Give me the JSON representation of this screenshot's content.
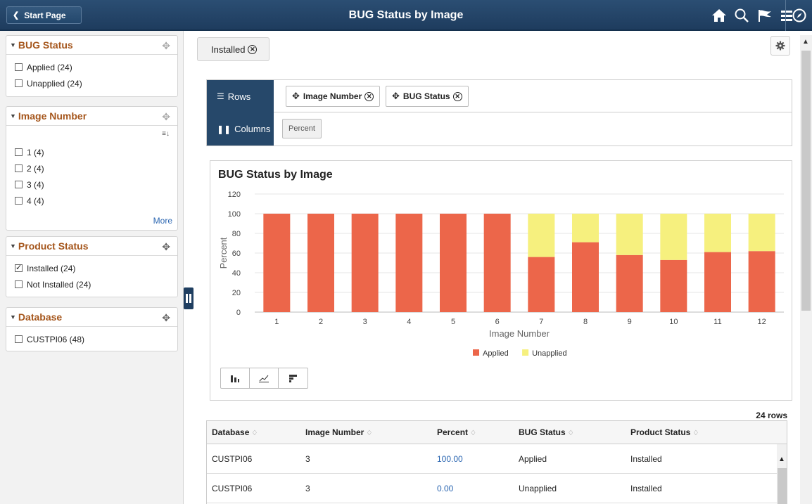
{
  "header": {
    "start_label": "Start Page",
    "title": "BUG Status by Image",
    "icons": [
      "home-icon",
      "search-icon",
      "flag-icon",
      "menu-icon",
      "compass-icon"
    ]
  },
  "facets": [
    {
      "title": "BUG Status",
      "items": [
        {
          "label": "Applied (24)",
          "checked": false
        },
        {
          "label": "Unapplied (24)",
          "checked": false
        }
      ]
    },
    {
      "title": "Image Number",
      "items": [
        {
          "label": "1 (4)",
          "checked": false
        },
        {
          "label": "2 (4)",
          "checked": false
        },
        {
          "label": "3 (4)",
          "checked": false
        },
        {
          "label": "4 (4)",
          "checked": false
        }
      ],
      "more": "More"
    },
    {
      "title": "Product Status",
      "items": [
        {
          "label": "Installed (24)",
          "checked": true
        },
        {
          "label": "Not Installed (24)",
          "checked": false
        }
      ]
    },
    {
      "title": "Database",
      "items": [
        {
          "label": "CUSTPI06 (48)",
          "checked": false
        }
      ]
    }
  ],
  "filter_chip": "Installed",
  "pivot": {
    "rows_label": "Rows",
    "columns_label": "Columns",
    "row_fields": [
      "Image Number",
      "BUG Status"
    ],
    "column_fields": [
      "Percent"
    ]
  },
  "chart_data": {
    "type": "bar",
    "stacked": true,
    "title": "BUG Status by Image",
    "xlabel": "Image Number",
    "ylabel": "Percent",
    "ylim": [
      0,
      120
    ],
    "yticks": [
      0,
      20,
      40,
      60,
      80,
      100,
      120
    ],
    "categories": [
      "1",
      "2",
      "3",
      "4",
      "5",
      "6",
      "7",
      "8",
      "9",
      "10",
      "11",
      "12"
    ],
    "series": [
      {
        "name": "Applied",
        "color": "#ec664a",
        "values": [
          100,
          100,
          100,
          100,
          100,
          100,
          56,
          71,
          58,
          53,
          61,
          62
        ]
      },
      {
        "name": "Unapplied",
        "color": "#f6f07e",
        "values": [
          0,
          0,
          0,
          0,
          0,
          0,
          44,
          29,
          42,
          47,
          39,
          38
        ]
      }
    ],
    "legend": "bottom",
    "grid": true
  },
  "grid": {
    "row_count": "24 rows",
    "columns": [
      "Database",
      "Image Number",
      "Percent",
      "BUG Status",
      "Product Status"
    ],
    "rows": [
      [
        "CUSTPI06",
        "3",
        "100.00",
        "Applied",
        "Installed"
      ],
      [
        "CUSTPI06",
        "3",
        "0.00",
        "Unapplied",
        "Installed"
      ]
    ]
  }
}
